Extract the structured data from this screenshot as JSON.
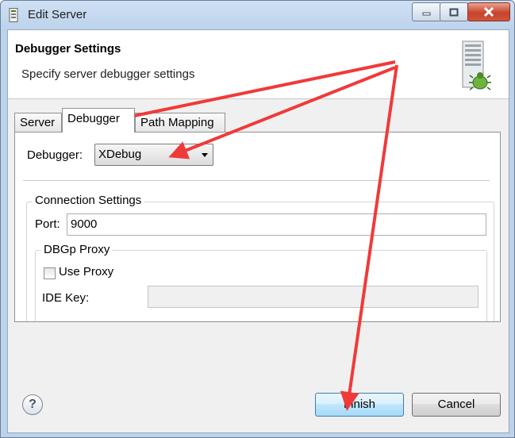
{
  "window": {
    "title": "Edit Server",
    "controls": [
      "minimize",
      "maximize",
      "close"
    ]
  },
  "header": {
    "title": "Debugger Settings",
    "description": "Specify server debugger settings",
    "icon": "server-debug-icon"
  },
  "tabs": [
    {
      "label": "Server",
      "active": false
    },
    {
      "label": "Debugger",
      "active": true
    },
    {
      "label": "Path Mapping",
      "active": false
    }
  ],
  "debugger": {
    "label": "Debugger:",
    "value": "XDebug"
  },
  "connection": {
    "group_title": "Connection Settings",
    "port_label": "Port:",
    "port_value": "9000"
  },
  "proxy": {
    "group_title": "DBGp Proxy",
    "use_proxy_label": "Use Proxy",
    "use_proxy_checked": false,
    "ide_key_label": "IDE Key:",
    "ide_key_value": ""
  },
  "footer": {
    "help_symbol": "?",
    "finish_label": "Finish",
    "cancel_label": "Cancel"
  },
  "colors": {
    "annotation_arrow": "#f03a3a",
    "title_bar": "#bcd3ec",
    "close_button": "#c7432b"
  }
}
